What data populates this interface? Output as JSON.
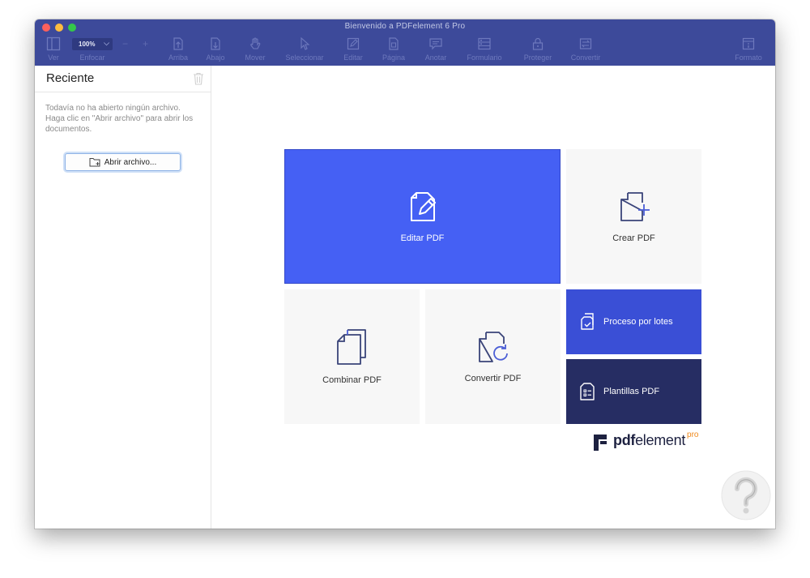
{
  "window": {
    "title": "Bienvenido a PDFelement 6 Pro"
  },
  "toolbar": {
    "zoom": "100%",
    "items": [
      {
        "label": "Ver",
        "icon": "panel-icon"
      },
      {
        "label": "Enfocar",
        "icon": "zoom-icon"
      },
      {
        "label": "Arriba",
        "icon": "page-up-icon"
      },
      {
        "label": "Abajo",
        "icon": "page-down-icon"
      },
      {
        "label": "Mover",
        "icon": "hand-icon"
      },
      {
        "label": "Seleccionar",
        "icon": "cursor-icon"
      },
      {
        "label": "Editar",
        "icon": "edit-icon"
      },
      {
        "label": "Página",
        "icon": "page-icon"
      },
      {
        "label": "Anotar",
        "icon": "comment-icon"
      },
      {
        "label": "Formulario",
        "icon": "form-icon"
      },
      {
        "label": "Proteger",
        "icon": "lock-icon"
      },
      {
        "label": "Convertir",
        "icon": "convert-icon"
      },
      {
        "label": "Formato",
        "icon": "format-icon"
      }
    ]
  },
  "sidebar": {
    "title": "Reciente",
    "empty_message": "Todavía no ha abierto ningún archivo. Haga clic en \"Abrir archivo\" para abrir los documentos.",
    "open_button": "Abrir archivo..."
  },
  "tiles": {
    "edit": "Editar PDF",
    "create": "Crear PDF",
    "combine": "Combinar PDF",
    "convert": "Convertir PDF",
    "batch": "Proceso por lotes",
    "templates": "Plantillas PDF"
  },
  "brand": {
    "name_bold": "pdf",
    "name_rest": "element",
    "edition": "pro"
  },
  "colors": {
    "titlebar": "#3d4a9a",
    "edit_tile": "#4560f4",
    "batch_tile": "#3a4fd6",
    "templates_tile": "#262d63",
    "light_tile": "#f7f7f7",
    "brand_accent": "#f0891b"
  }
}
